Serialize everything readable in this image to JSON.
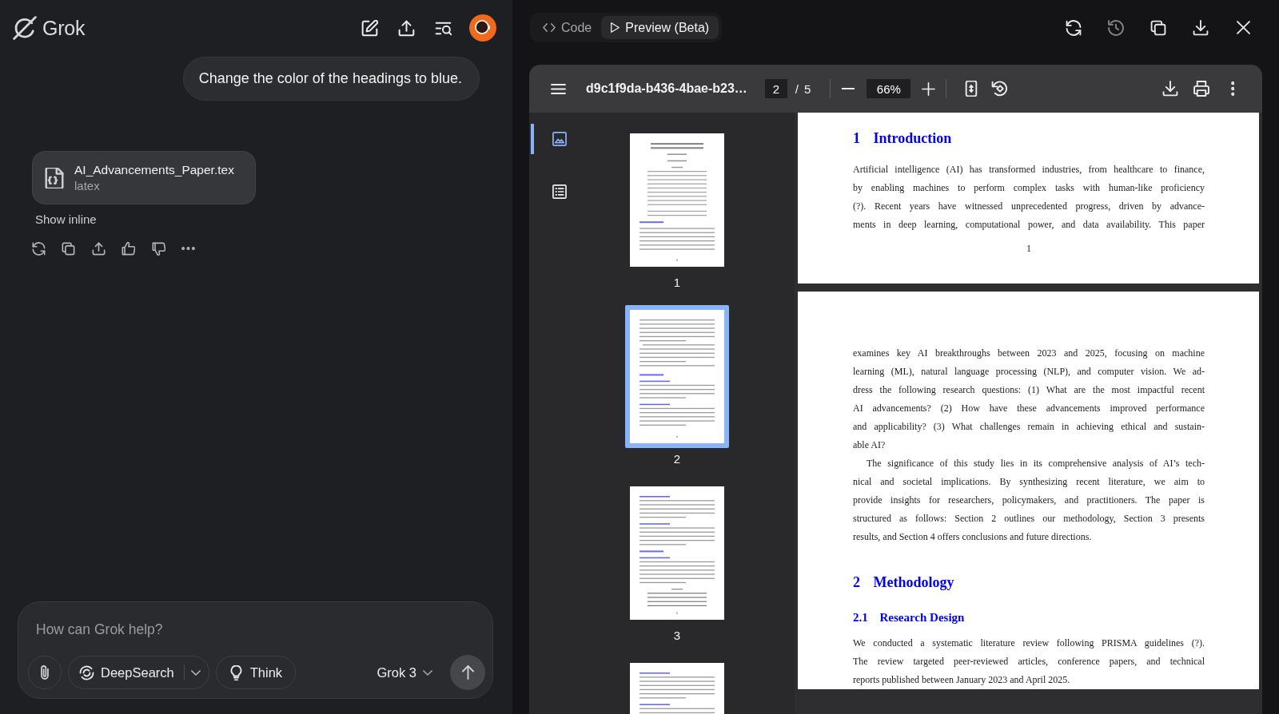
{
  "app": {
    "name": "Grok"
  },
  "chat": {
    "messages": [
      {
        "kind": "user",
        "text": "Change the color of the headings to blue."
      },
      {
        "kind": "file",
        "file_name": "AI_Advancements_Paper.tex",
        "file_type": "latex",
        "link": "Show inline"
      }
    ]
  },
  "composer": {
    "placeholder": "How can Grok help?",
    "modes": [
      {
        "kind": "deepsearch",
        "label": "DeepSearch"
      },
      {
        "kind": "think",
        "label": "Think"
      }
    ],
    "model": "Grok 3"
  },
  "preview": {
    "tabs": [
      {
        "kind": "code",
        "label": "Code",
        "selected": false
      },
      {
        "kind": "preview",
        "label": "Preview (Beta)",
        "selected": true
      }
    ],
    "actions": [
      {
        "kind": "refresh",
        "disabled": false
      },
      {
        "kind": "history",
        "disabled": true
      },
      {
        "kind": "copy",
        "disabled": false
      },
      {
        "kind": "download",
        "disabled": false
      },
      {
        "kind": "close",
        "disabled": false
      }
    ]
  },
  "pdf": {
    "file_name": "d9c1f9da-b436-4bae-b23…",
    "page": "2",
    "page_divider": "/",
    "page_count": "5",
    "zoom": "66%",
    "sidebar_tabs": [
      {
        "kind": "thumbnails",
        "selected": true
      },
      {
        "kind": "outline",
        "selected": false
      }
    ],
    "thumbnails": [
      {
        "label": "1",
        "selected": false
      },
      {
        "label": "2",
        "selected": true
      },
      {
        "label": "3",
        "selected": false
      },
      {
        "selected": false
      }
    ],
    "pages": [
      {
        "blocks": [
          {
            "kind": "section",
            "number": "1",
            "title": "Introduction"
          },
          {
            "kind": "paragraph",
            "indent": false,
            "continues": true,
            "lines": [
              "Artificial intelligence (AI) has transformed industries, from healthcare to finance,",
              "by enabling machines to perform complex tasks with human-like proficiency",
              "(?). Recent years have witnessed unprecedented progress, driven by advance-",
              "ments in deep learning, computational power, and data availability. This paper"
            ]
          }
        ],
        "footer": "1"
      },
      {
        "blocks": [
          {
            "kind": "paragraph",
            "indent": false,
            "continues": false,
            "lines": [
              "examines key AI breakthroughs between 2023 and 2025, focusing on machine",
              "learning (ML), natural language processing (NLP), and computer vision. We ad-",
              "dress the following research questions: (1) What are the most impactful recent",
              "AI advancements? (2) How have these advancements improved performance",
              "and applicability? (3) What challenges remain in achieving ethical and sustain-",
              "able AI?"
            ]
          },
          {
            "kind": "paragraph",
            "indent": true,
            "continues": false,
            "lines": [
              "The significance of this study lies in its comprehensive analysis of AI’s tech-",
              "nical and societal implications. By synthesizing recent literature, we aim to",
              "provide insights for researchers, policymakers, and practitioners. The paper is",
              "structured as follows: Section 2 outlines our methodology, Section 3 presents",
              "results, and Section 4 offers conclusions and future directions."
            ]
          },
          {
            "kind": "section",
            "number": "2",
            "title": "Methodology"
          },
          {
            "kind": "subsection",
            "number": "2.1",
            "title": "Research Design"
          },
          {
            "kind": "paragraph",
            "indent": false,
            "continues": false,
            "lines": [
              "We conducted a systematic literature review following PRISMA guidelines (?).",
              "The review targeted peer-reviewed articles, conference papers, and technical",
              "reports published between January 2023 and April 2025."
            ]
          }
        ]
      }
    ]
  }
}
